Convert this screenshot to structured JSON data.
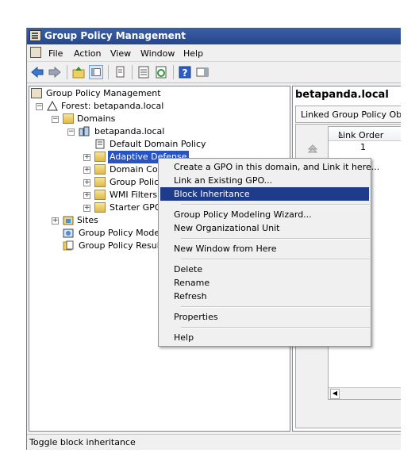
{
  "window": {
    "title": "Group Policy Management"
  },
  "menu": [
    "File",
    "Action",
    "View",
    "Window",
    "Help"
  ],
  "tree": {
    "root": "Group Policy Management",
    "forest": "Forest: betapanda.local",
    "domains": "Domains",
    "domain": "betapanda.local",
    "children": [
      "Default Domain Policy",
      "Adaptive Defense",
      "Domain Contr",
      "Group Policy",
      "WMI Filters",
      "Starter GPOs"
    ],
    "sites": "Sites",
    "modeling": "Group Policy Modeling",
    "results": "Group Policy Results"
  },
  "right": {
    "title": "betapanda.local",
    "tab": "Linked Group Policy Object",
    "column": "Link Order",
    "sort_glyph": "▲",
    "row_value": "1"
  },
  "context_menu": {
    "groups": [
      [
        "Create a GPO in this domain, and Link it here...",
        "Link an Existing GPO...",
        "Block Inheritance"
      ],
      [
        "Group Policy Modeling Wizard...",
        "New Organizational Unit"
      ],
      [
        "New Window from Here"
      ],
      [
        "Delete",
        "Rename",
        "Refresh"
      ],
      [
        "Properties"
      ],
      [
        "Help"
      ]
    ],
    "highlighted": "Block Inheritance"
  },
  "status": "Toggle block inheritance",
  "colors": {
    "title_bar": "#2c4f97",
    "selection": "#2a53c2",
    "menu_highlight": "#1f3b8c"
  }
}
